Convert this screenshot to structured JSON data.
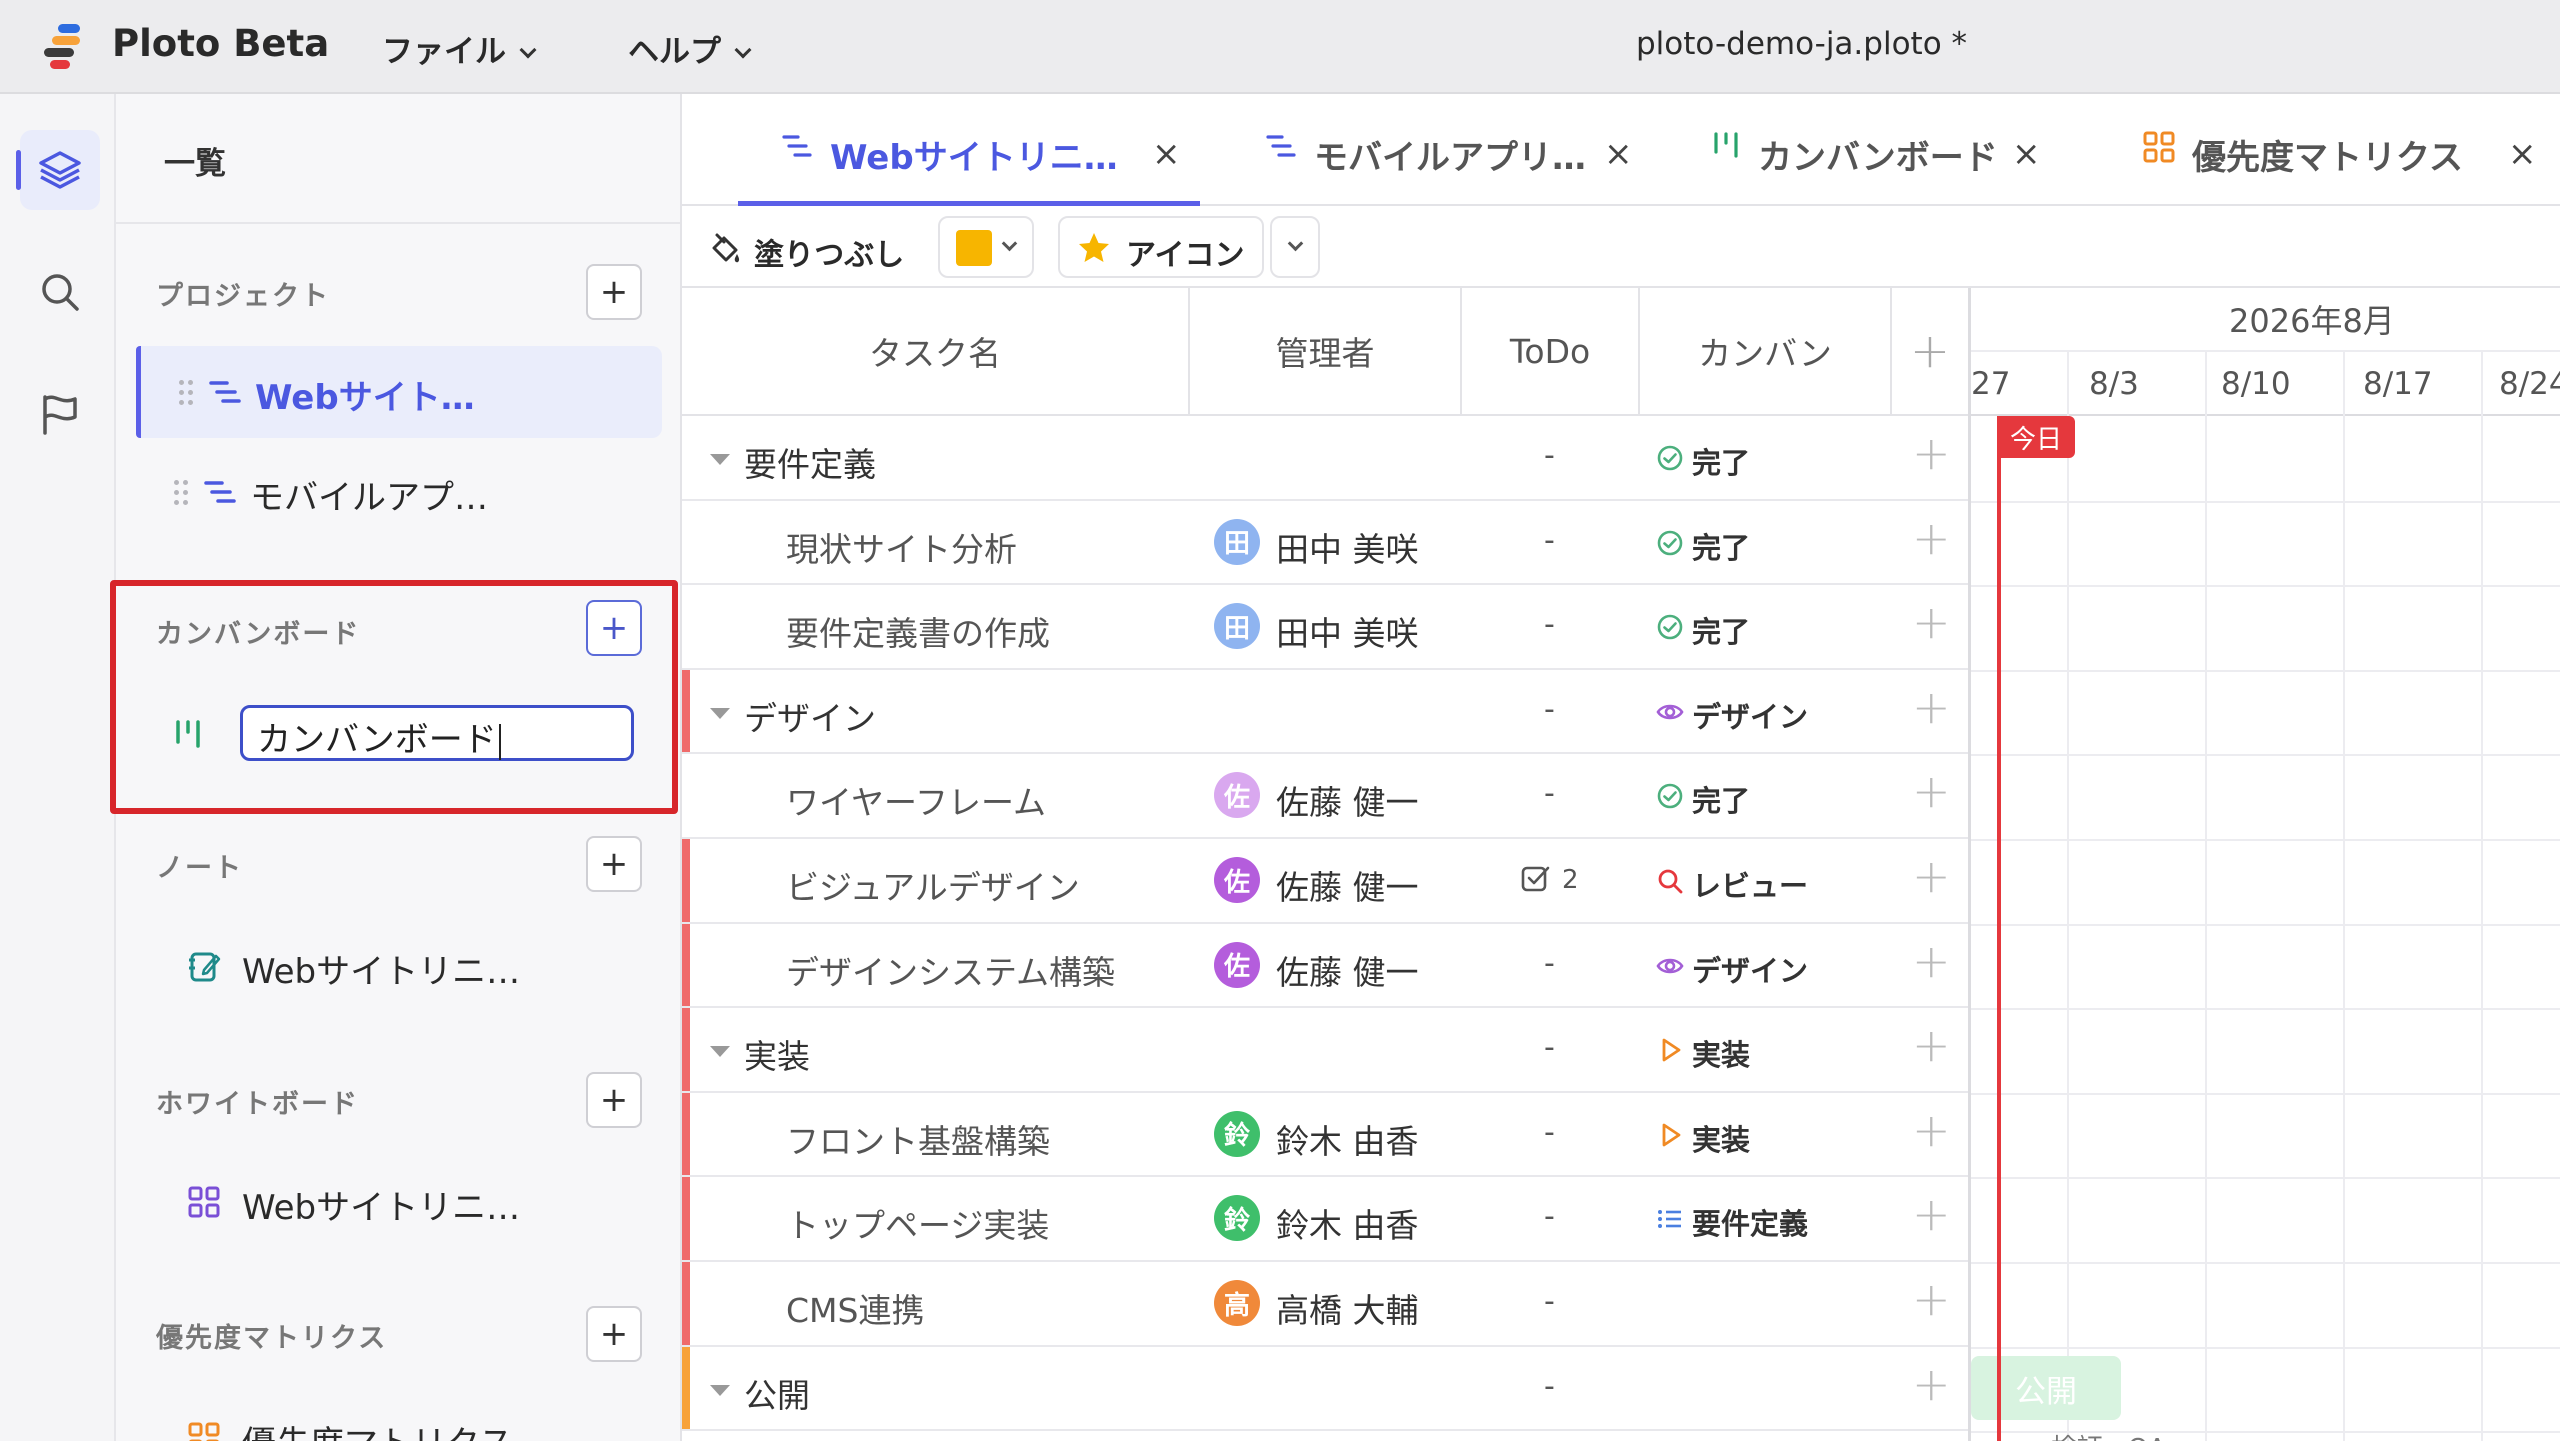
{
  "app": {
    "name": "Ploto Beta",
    "menus": [
      "ファイル",
      "ヘルプ"
    ],
    "document_title": "ploto-demo-ja.ploto *"
  },
  "rail": {
    "items": [
      "layers-icon",
      "search-icon",
      "flag-icon"
    ],
    "active": "layers-icon"
  },
  "sidebar": {
    "title": "一覧",
    "sections": {
      "project": {
        "label": "プロジェクト",
        "items": [
          "Webサイト…",
          "モバイルアプ…"
        ]
      },
      "kanban": {
        "label": "カンバンボード",
        "editing_value": "カンバンボード"
      },
      "note": {
        "label": "ノート",
        "items": [
          "Webサイトリニ…"
        ]
      },
      "whiteboard": {
        "label": "ホワイトボード",
        "items": [
          "Webサイトリニ…"
        ]
      },
      "matrix": {
        "label": "優先度マトリクス",
        "items": [
          "優先度マトリクス"
        ]
      }
    },
    "add_label": "+"
  },
  "tabs": [
    {
      "label": "Webサイトリニ…",
      "icon": "gantt-icon",
      "active": true
    },
    {
      "label": "モバイルアプリ…",
      "icon": "gantt-icon",
      "active": false
    },
    {
      "label": "カンバンボード",
      "icon": "kanban-icon",
      "active": false
    },
    {
      "label": "優先度マトリクス",
      "icon": "grid-icon",
      "active": false
    }
  ],
  "tab_close": "×",
  "toolbar": {
    "fill_label": "塗りつぶし",
    "fill_color": "#f7b500",
    "icon_label": "アイコン"
  },
  "table": {
    "columns": [
      "タスク名",
      "管理者",
      "ToDo",
      "カンバン"
    ],
    "add_column": "+",
    "rows": [
      {
        "type": "group",
        "task": "要件定義",
        "manager": "",
        "avatar": "",
        "avatar_color": "",
        "todo": "-",
        "todo_count": "",
        "status": "完了",
        "status_icon": "check-circle-icon",
        "status_color": "#4caf7d",
        "accent": ""
      },
      {
        "type": "task",
        "task": "現状サイト分析",
        "manager": "田中 美咲",
        "avatar": "田",
        "avatar_color": "#8fb4f0",
        "todo": "-",
        "todo_count": "",
        "status": "完了",
        "status_icon": "check-circle-icon",
        "status_color": "#4caf7d",
        "accent": ""
      },
      {
        "type": "task",
        "task": "要件定義書の作成",
        "manager": "田中 美咲",
        "avatar": "田",
        "avatar_color": "#8fb4f0",
        "todo": "-",
        "todo_count": "",
        "status": "完了",
        "status_icon": "check-circle-icon",
        "status_color": "#4caf7d",
        "accent": ""
      },
      {
        "type": "group",
        "task": "デザイン",
        "manager": "",
        "avatar": "",
        "avatar_color": "",
        "todo": "-",
        "todo_count": "",
        "status": "デザイン",
        "status_icon": "eye-icon",
        "status_color": "#a35fd6",
        "accent": "#ef6b6b"
      },
      {
        "type": "task",
        "task": "ワイヤーフレーム",
        "manager": "佐藤 健一",
        "avatar": "佐",
        "avatar_color": "#d9a8ef",
        "todo": "-",
        "todo_count": "",
        "status": "完了",
        "status_icon": "check-circle-icon",
        "status_color": "#4caf7d",
        "accent": ""
      },
      {
        "type": "task",
        "task": "ビジュアルデザイン",
        "manager": "佐藤 健一",
        "avatar": "佐",
        "avatar_color": "#b45ddc",
        "todo": "",
        "todo_count": "2",
        "status": "レビュー",
        "status_icon": "search-icon",
        "status_color": "#e5383d",
        "accent": "#ef6b6b"
      },
      {
        "type": "task",
        "task": "デザインシステム構築",
        "manager": "佐藤 健一",
        "avatar": "佐",
        "avatar_color": "#b45ddc",
        "todo": "-",
        "todo_count": "",
        "status": "デザイン",
        "status_icon": "eye-icon",
        "status_color": "#a35fd6",
        "accent": "#ef6b6b"
      },
      {
        "type": "group",
        "task": "実装",
        "manager": "",
        "avatar": "",
        "avatar_color": "",
        "todo": "-",
        "todo_count": "",
        "status": "実装",
        "status_icon": "play-icon",
        "status_color": "#f08a24",
        "accent": "#ef6b6b"
      },
      {
        "type": "task",
        "task": "フロント基盤構築",
        "manager": "鈴木 由香",
        "avatar": "鈴",
        "avatar_color": "#3fbf6b",
        "todo": "-",
        "todo_count": "",
        "status": "実装",
        "status_icon": "play-icon",
        "status_color": "#f08a24",
        "accent": "#ef6b6b"
      },
      {
        "type": "task",
        "task": "トップページ実装",
        "manager": "鈴木 由香",
        "avatar": "鈴",
        "avatar_color": "#3fbf6b",
        "todo": "-",
        "todo_count": "",
        "status": "要件定義",
        "status_icon": "list-icon",
        "status_color": "#4a7fe0",
        "accent": "#ef6b6b"
      },
      {
        "type": "task",
        "task": "CMS連携",
        "manager": "高橋 大輔",
        "avatar": "高",
        "avatar_color": "#f0893a",
        "todo": "-",
        "todo_count": "",
        "status": "",
        "status_icon": "",
        "status_color": "",
        "accent": "#ef6b6b"
      },
      {
        "type": "group",
        "task": "公開",
        "manager": "",
        "avatar": "",
        "avatar_color": "",
        "todo": "-",
        "todo_count": "",
        "status": "",
        "status_icon": "",
        "status_color": "",
        "accent": "#f7a23a"
      }
    ]
  },
  "gantt": {
    "month": "2026年8月",
    "weeks": [
      "27",
      "8/3",
      "8/10",
      "8/17",
      "8/24"
    ],
    "today_label": "今日",
    "bar_label": "公開",
    "next_label": "検証 · QA"
  }
}
